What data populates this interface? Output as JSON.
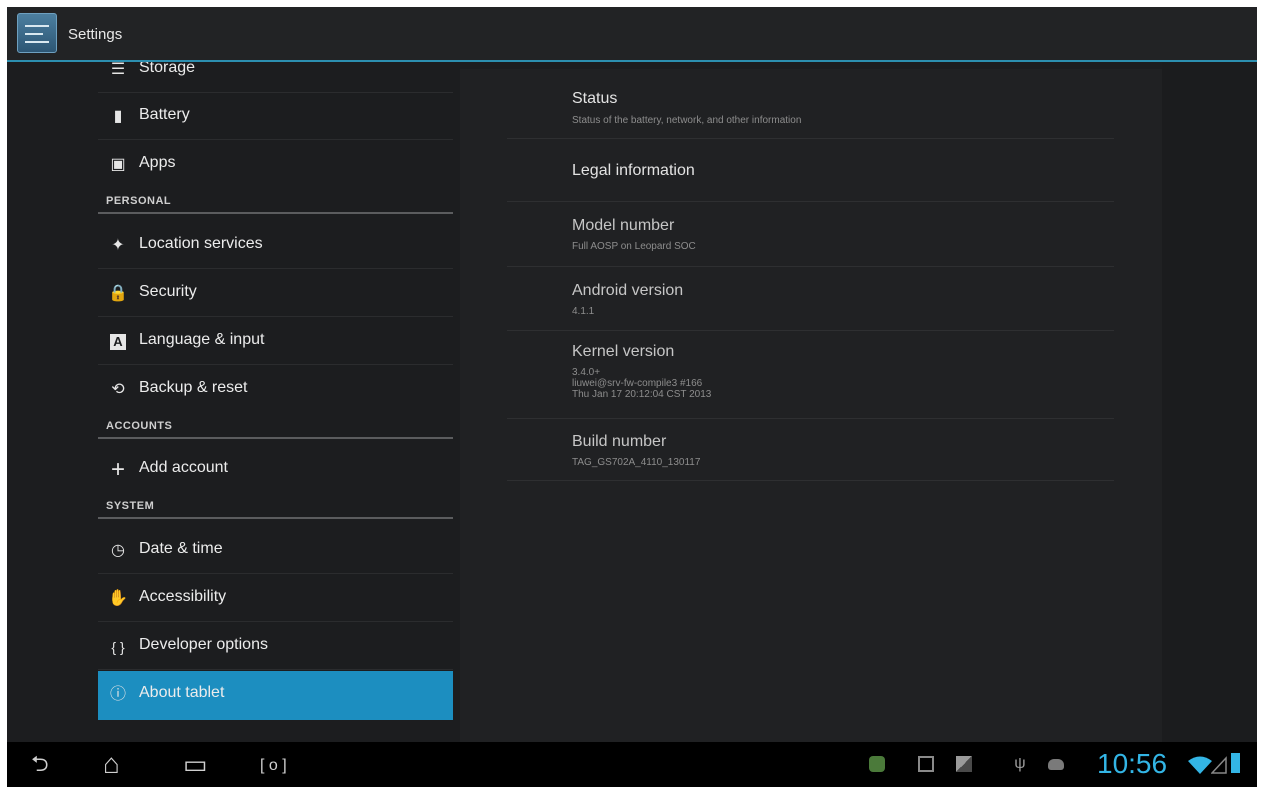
{
  "app": {
    "title": "Settings",
    "icon": "settings-sliders-icon"
  },
  "sidebar": {
    "items": [
      {
        "label": "Storage",
        "icon": "storage-icon",
        "glyph": "☰"
      },
      {
        "label": "Battery",
        "icon": "battery-icon",
        "glyph": "▮"
      },
      {
        "label": "Apps",
        "icon": "apps-icon",
        "glyph": "▣"
      },
      {
        "label": "Location services",
        "icon": "location-icon",
        "glyph": "✦"
      },
      {
        "label": "Security",
        "icon": "lock-icon",
        "glyph": "🔒"
      },
      {
        "label": "Language & input",
        "icon": "keyboard-icon",
        "glyph": "A"
      },
      {
        "label": "Backup & reset",
        "icon": "backup-icon",
        "glyph": "⟲"
      },
      {
        "label": "Add account",
        "icon": "plus-icon",
        "glyph": "+"
      },
      {
        "label": "Date & time",
        "icon": "clock-icon",
        "glyph": "◷"
      },
      {
        "label": "Accessibility",
        "icon": "hand-icon",
        "glyph": "✋"
      },
      {
        "label": "Developer options",
        "icon": "braces-icon",
        "glyph": "{ }"
      },
      {
        "label": "About tablet",
        "icon": "info-icon",
        "glyph": "ⓘ",
        "selected": true
      }
    ],
    "headers": {
      "personal": "PERSONAL",
      "accounts": "ACCOUNTS",
      "system": "SYSTEM"
    }
  },
  "about": {
    "status": {
      "title": "Status",
      "summary": "Status of the battery, network, and other information"
    },
    "legal": {
      "title": "Legal information"
    },
    "model": {
      "title": "Model number",
      "value": "Full AOSP on Leopard SOC"
    },
    "android": {
      "title": "Android version",
      "value": "4.1.1"
    },
    "kernel": {
      "title": "Kernel version",
      "line1": "3.4.0+",
      "line2": "liuwei@srv-fw-compile3 #166",
      "line3": "Thu Jan 17 20:12:04 CST 2013"
    },
    "build": {
      "title": "Build number",
      "value": "TAG_GS702A_4110_130117"
    }
  },
  "navbar": {
    "back_glyph": "⮌",
    "home_glyph": "⌂",
    "recents_glyph": "▭",
    "screenshot_glyph": "[ o ]",
    "clock": "10:56"
  },
  "colors": {
    "accent": "#1c8ec0",
    "clock": "#33b5e5",
    "background": "#1c1d1f"
  }
}
